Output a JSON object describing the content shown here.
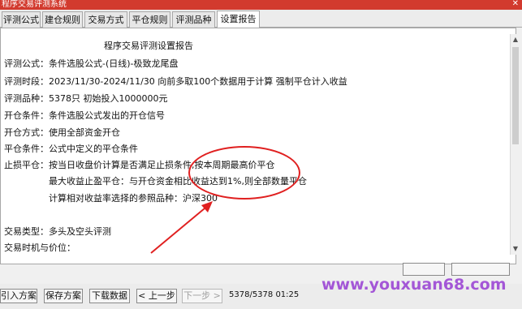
{
  "window": {
    "title": "程序交易评测系统",
    "close_glyph": "✕"
  },
  "tabs": [
    {
      "label": "评测公式"
    },
    {
      "label": "建仓规则"
    },
    {
      "label": "交易方式"
    },
    {
      "label": "平仓规则"
    },
    {
      "label": "评测品种"
    },
    {
      "label": "设置报告"
    }
  ],
  "report": {
    "title": "程序交易评测设置报告",
    "lines": [
      "评测公式：条件选股公式-(日线)-极致龙尾盘",
      "评测时段：2023/11/30-2024/11/30 向前多取100个数据用于计算 强制平仓计入收益",
      "评测品种：5378只 初始投入1000000元",
      "开仓条件：条件选股公式发出的开仓信号",
      "开仓方式：使用全部资金开仓",
      "平仓条件：公式中定义的平仓条件",
      "止损平仓：按当日收盘价计算是否满足止损条件,按本周期最高价平仓",
      "最大收益止盈平仓：与开仓资金相比收益达到1%,则全部数量平仓",
      "计算相对收益率选择的参照品种：沪深300",
      "交易类型：多头及空头评测",
      "交易时机与价位："
    ]
  },
  "bottom": {
    "buttons": [
      "引入方案",
      "保存方案",
      "下载数据",
      "< 上一步",
      "下一步 >"
    ],
    "status": "5378/5378 01:25"
  },
  "watermark": "www.youxuan68.com",
  "colors": {
    "annotation": "#e02020",
    "titlebar": "#d23a2e",
    "watermark": "#963cd2"
  }
}
